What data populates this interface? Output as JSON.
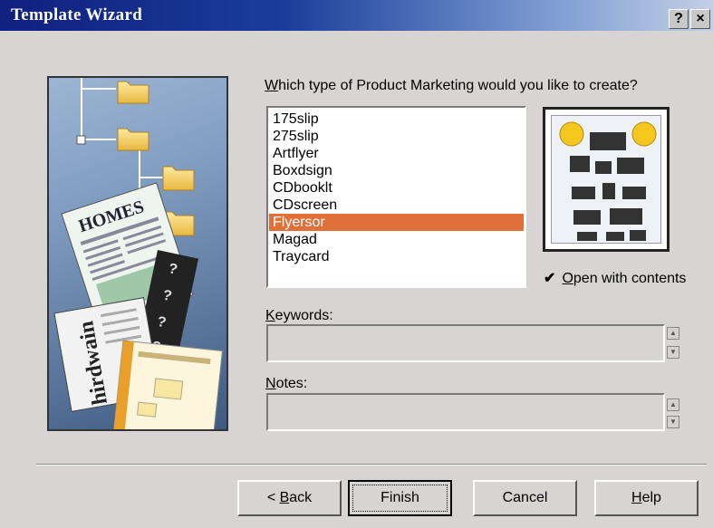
{
  "window": {
    "title": "Template Wizard",
    "help_button": "?",
    "close_button": "×"
  },
  "prompt": {
    "hotkey": "W",
    "rest": "hich type of Product Marketing would you like to create?"
  },
  "templates": {
    "selected_index": 6,
    "items": [
      "175slip",
      "275slip",
      "Artflyer",
      "Boxdsign",
      "CDbooklt",
      "CDscreen",
      "Flyersor",
      "Magad",
      "Traycard"
    ]
  },
  "open_with_contents": {
    "checked": true,
    "check_glyph": "✔",
    "hotkey": "O",
    "rest": "pen with contents"
  },
  "keywords": {
    "hotkey": "K",
    "rest": "eywords:",
    "value": ""
  },
  "notes": {
    "hotkey": "N",
    "rest": "otes:",
    "value": ""
  },
  "illustration": {
    "newspaper_headline": "HOMES",
    "rotated_text": "hirdwain"
  },
  "buttons": {
    "back": {
      "prefix": "< ",
      "hotkey": "B",
      "rest": "ack"
    },
    "finish": {
      "label": "Finish"
    },
    "cancel": {
      "label": "Cancel"
    },
    "help": {
      "hotkey": "H",
      "rest": "elp"
    }
  },
  "colors": {
    "selection": "#e0703a",
    "title_gradient_start": "#10207e",
    "dialog_bg": "#d8d4d4"
  }
}
